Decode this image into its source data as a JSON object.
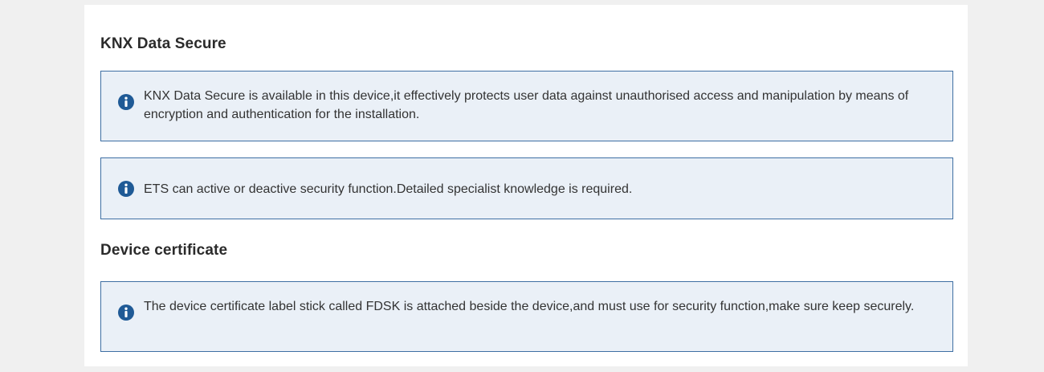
{
  "sections": [
    {
      "title": "KNX Data Secure",
      "messages": [
        "KNX Data Secure is available in this device,it effectively protects user data against unauthorised access and manipulation by means of encryption and authentication for the installation.",
        "ETS can active or deactive security function.Detailed specialist knowledge is required."
      ]
    },
    {
      "title": "Device certificate",
      "messages": [
        "The device certificate label stick called FDSK is attached beside the device,and must use for security function,make sure keep securely."
      ]
    }
  ],
  "colors": {
    "info_background": "#eaf0f7",
    "info_border": "#3e6fa3",
    "info_icon": "#1f5a96"
  },
  "icons": {
    "info": "info-circle-icon"
  }
}
